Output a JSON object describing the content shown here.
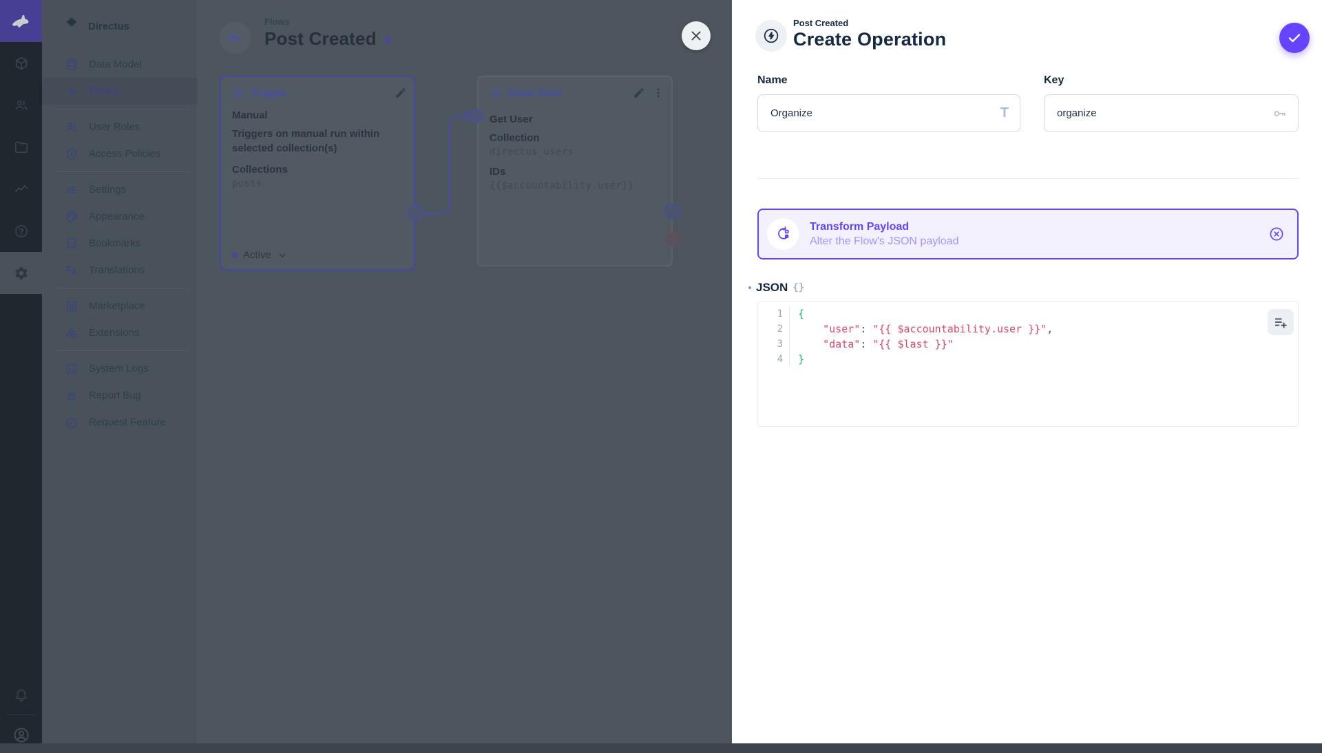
{
  "colors": {
    "accent": "#6644ff",
    "code_key": "#e0486a",
    "code_bracket": "#2eab74",
    "drawer_bg": "#ffffff",
    "dim_purple": "#4a4da6"
  },
  "module_bar": {
    "modules": [
      {
        "name": "content",
        "icon": "box",
        "active": false
      },
      {
        "name": "user-directory",
        "icon": "users",
        "active": false
      },
      {
        "name": "file-library",
        "icon": "folder",
        "active": false
      },
      {
        "name": "insights",
        "icon": "activity",
        "active": false
      },
      {
        "name": "docs",
        "icon": "help",
        "active": false
      },
      {
        "name": "settings",
        "icon": "gear",
        "active": true
      }
    ],
    "bottom": {
      "notifications_icon": "bell",
      "avatar_icon": "person-circle"
    }
  },
  "sidebar": {
    "project": "Directus",
    "sections": [
      {
        "items": [
          {
            "label": "Data Model",
            "icon": "database",
            "active": false
          },
          {
            "label": "Flows",
            "icon": "bolt",
            "active": true
          }
        ]
      },
      {
        "items": [
          {
            "label": "User Roles",
            "icon": "users",
            "active": false
          },
          {
            "label": "Access Policies",
            "icon": "shield",
            "active": false
          }
        ]
      },
      {
        "items": [
          {
            "label": "Settings",
            "icon": "tune",
            "active": false
          },
          {
            "label": "Appearance",
            "icon": "palette",
            "active": false
          },
          {
            "label": "Bookmarks",
            "icon": "bookmark",
            "active": false
          },
          {
            "label": "Translations",
            "icon": "translate",
            "active": false
          }
        ]
      },
      {
        "items": [
          {
            "label": "Marketplace",
            "icon": "store",
            "active": false
          },
          {
            "label": "Extensions",
            "icon": "category",
            "active": false
          }
        ]
      },
      {
        "items": [
          {
            "label": "System Logs",
            "icon": "terminal",
            "active": false
          },
          {
            "label": "Report Bug",
            "icon": "bug",
            "active": false
          },
          {
            "label": "Request Feature",
            "icon": "badge-check",
            "active": false
          }
        ]
      }
    ]
  },
  "flow": {
    "breadcrumb": "Flows",
    "title": "Post Created",
    "trigger": {
      "title": "Trigger",
      "type": "Manual",
      "description_line1": "Triggers on manual run within",
      "description_line2": "selected collection(s)",
      "collections_label": "Collections",
      "collections_value": "posts",
      "status": "Active"
    },
    "read_data": {
      "title": "Read Data",
      "operation_name": "Get User",
      "collection_label": "Collection",
      "collection_value": "directus_users",
      "ids_label": "IDs",
      "ids_value": "{{$accountability.user}}"
    }
  },
  "drawer": {
    "supertitle": "Post Created",
    "title": "Create Operation",
    "name": {
      "label": "Name",
      "value": "Organize"
    },
    "key": {
      "label": "Key",
      "value": "organize"
    },
    "operation": {
      "title": "Transform Payload",
      "subtitle": "Alter the Flow's JSON payload"
    },
    "json": {
      "label": "JSON",
      "raw_toggle": "{}",
      "lines": [
        {
          "num": "1",
          "tokens": [
            [
              "bracket",
              "{"
            ]
          ]
        },
        {
          "num": "2",
          "tokens": [
            [
              "plain",
              "    "
            ],
            [
              "key",
              "\"user\""
            ],
            [
              "plain",
              ": "
            ],
            [
              "string",
              "\"{{ $accountability.user }}\""
            ],
            [
              "plain",
              ","
            ]
          ]
        },
        {
          "num": "3",
          "tokens": [
            [
              "plain",
              "    "
            ],
            [
              "key",
              "\"data\""
            ],
            [
              "plain",
              ": "
            ],
            [
              "string",
              "\"{{ $last }}\""
            ]
          ]
        },
        {
          "num": "4",
          "tokens": [
            [
              "bracket",
              "}"
            ]
          ]
        }
      ]
    }
  }
}
